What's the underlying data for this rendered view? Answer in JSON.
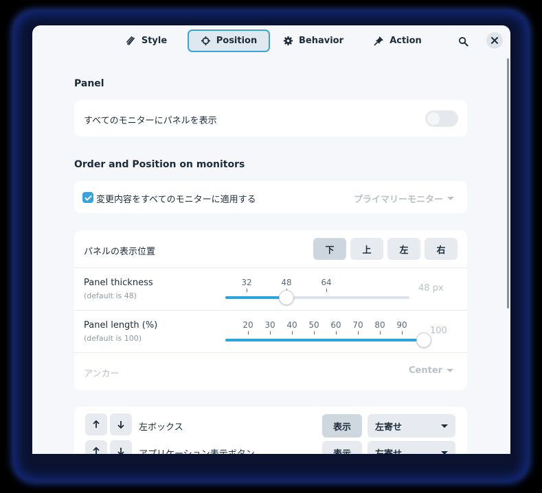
{
  "tabs": [
    {
      "label": "Style",
      "icon": "brush-icon",
      "active": false
    },
    {
      "label": "Position",
      "icon": "crosshair-icon",
      "active": true
    },
    {
      "label": "Behavior",
      "icon": "gear-icon",
      "active": false
    },
    {
      "label": "Action",
      "icon": "pin-icon",
      "active": false
    }
  ],
  "panel_section": {
    "title": "Panel",
    "show_on_all_monitors_label": "すべてのモニターにパネルを表示",
    "show_on_all_monitors": false
  },
  "order_section": {
    "title": "Order and Position on monitors",
    "apply_all_label": "変更内容をすべてのモニターに適用する",
    "apply_all_checked": true,
    "monitor_dropdown": "プライマリーモニター"
  },
  "position_card": {
    "position_label": "パネルの表示位置",
    "positions": [
      "下",
      "上",
      "左",
      "右"
    ],
    "selected_position": "下",
    "thickness": {
      "label": "Panel thickness",
      "default_text": "(default is 48)",
      "ticks": [
        "32",
        "48",
        "64"
      ],
      "value": 48,
      "value_text": "48 px"
    },
    "length": {
      "label": "Panel length (%)",
      "default_text": "(default is 100)",
      "ticks": [
        "20",
        "30",
        "40",
        "50",
        "60",
        "70",
        "80",
        "90"
      ],
      "value": 100,
      "value_text": "100"
    },
    "anchor_label": "アンカー",
    "anchor_value": "Center"
  },
  "elements_list": [
    {
      "label": "左ボックス",
      "show_label": "表示",
      "align": "左寄せ"
    },
    {
      "label": "アプリケーション表示ボタン",
      "show_label": "表示",
      "align": "左寄せ"
    }
  ],
  "colors": {
    "accent": "#3aa3dc",
    "window_bg": "#f5f7fa"
  }
}
